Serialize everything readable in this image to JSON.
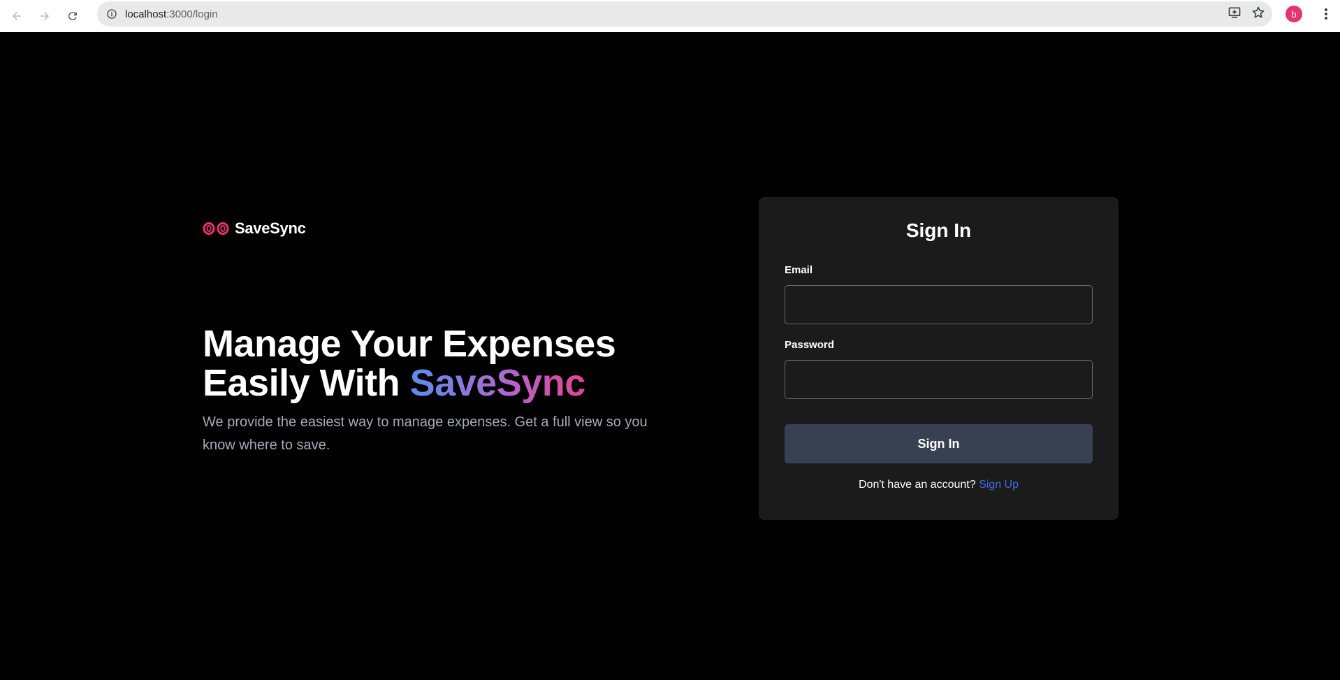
{
  "browser": {
    "url_host": "localhost",
    "url_path": ":3000/login",
    "avatar_letter": "b",
    "icons": [
      "back-arrow-icon",
      "forward-arrow-icon",
      "reload-icon",
      "info-icon",
      "install-app-icon",
      "star-icon",
      "kebab-menu-icon"
    ]
  },
  "brand": {
    "name": "SaveSync",
    "accent": "#e8336f"
  },
  "hero": {
    "title_line1": "Manage Your Expenses",
    "title_line2_prefix": "Easily With ",
    "title_line2_highlight": "SaveSync",
    "subtitle": "We provide the easiest way to manage expenses. Get a full view so you know where to save."
  },
  "form": {
    "title": "Sign In",
    "email_label": "Email",
    "email_value": "",
    "password_label": "Password",
    "password_value": "",
    "submit_label": "Sign In",
    "signup_prompt": "Don't have an account? ",
    "signup_link": "Sign Up"
  },
  "colors": {
    "background": "#000000",
    "card": "#1b1b1c",
    "button": "#374151",
    "link": "#3b6fe0",
    "gradient_start": "#5b8def",
    "gradient_end": "#e8438f"
  }
}
